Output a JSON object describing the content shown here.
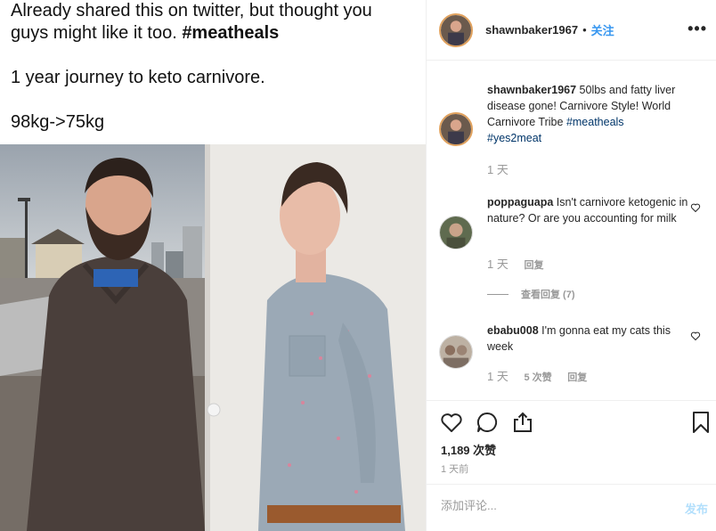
{
  "tweet": {
    "line1": "Already shared this on twitter, but thought you",
    "line2_prefix": "guys might like it too.",
    "line2_hashtag": "#meatheals",
    "line3": "1 year journey to keto carnivore.",
    "line4": "98kg->75kg"
  },
  "header": {
    "username": "shawnbaker1967",
    "separator": "•",
    "follow": "关注",
    "more": "•••"
  },
  "caption": {
    "username": "shawnbaker1967",
    "text": " 50lbs and fatty liver disease gone! Carnivore Style! World Carnivore Tribe ",
    "tag1": "#meatheals",
    "tag2": "#yes2meat",
    "time": "1 天"
  },
  "comments": [
    {
      "username": "poppaguapa",
      "text": " Isn't carnivore ketogenic in nature? Or are you accounting for milk",
      "time": "1 天",
      "reply": "回复",
      "view_replies": "查看回复 (7)"
    },
    {
      "username": "ebabu008",
      "text": " I'm gonna eat my cats this week",
      "time": "1 天",
      "likes": "5 次赞",
      "reply": "回复"
    }
  ],
  "post": {
    "likes": "1,189 次赞",
    "time": "1 天前",
    "comment_placeholder": "添加评论...",
    "post_button": "发布"
  },
  "colors": {
    "link": "#003569",
    "follow": "#3897f0",
    "muted": "#999999",
    "post_button_disabled": "#b2dffc"
  }
}
